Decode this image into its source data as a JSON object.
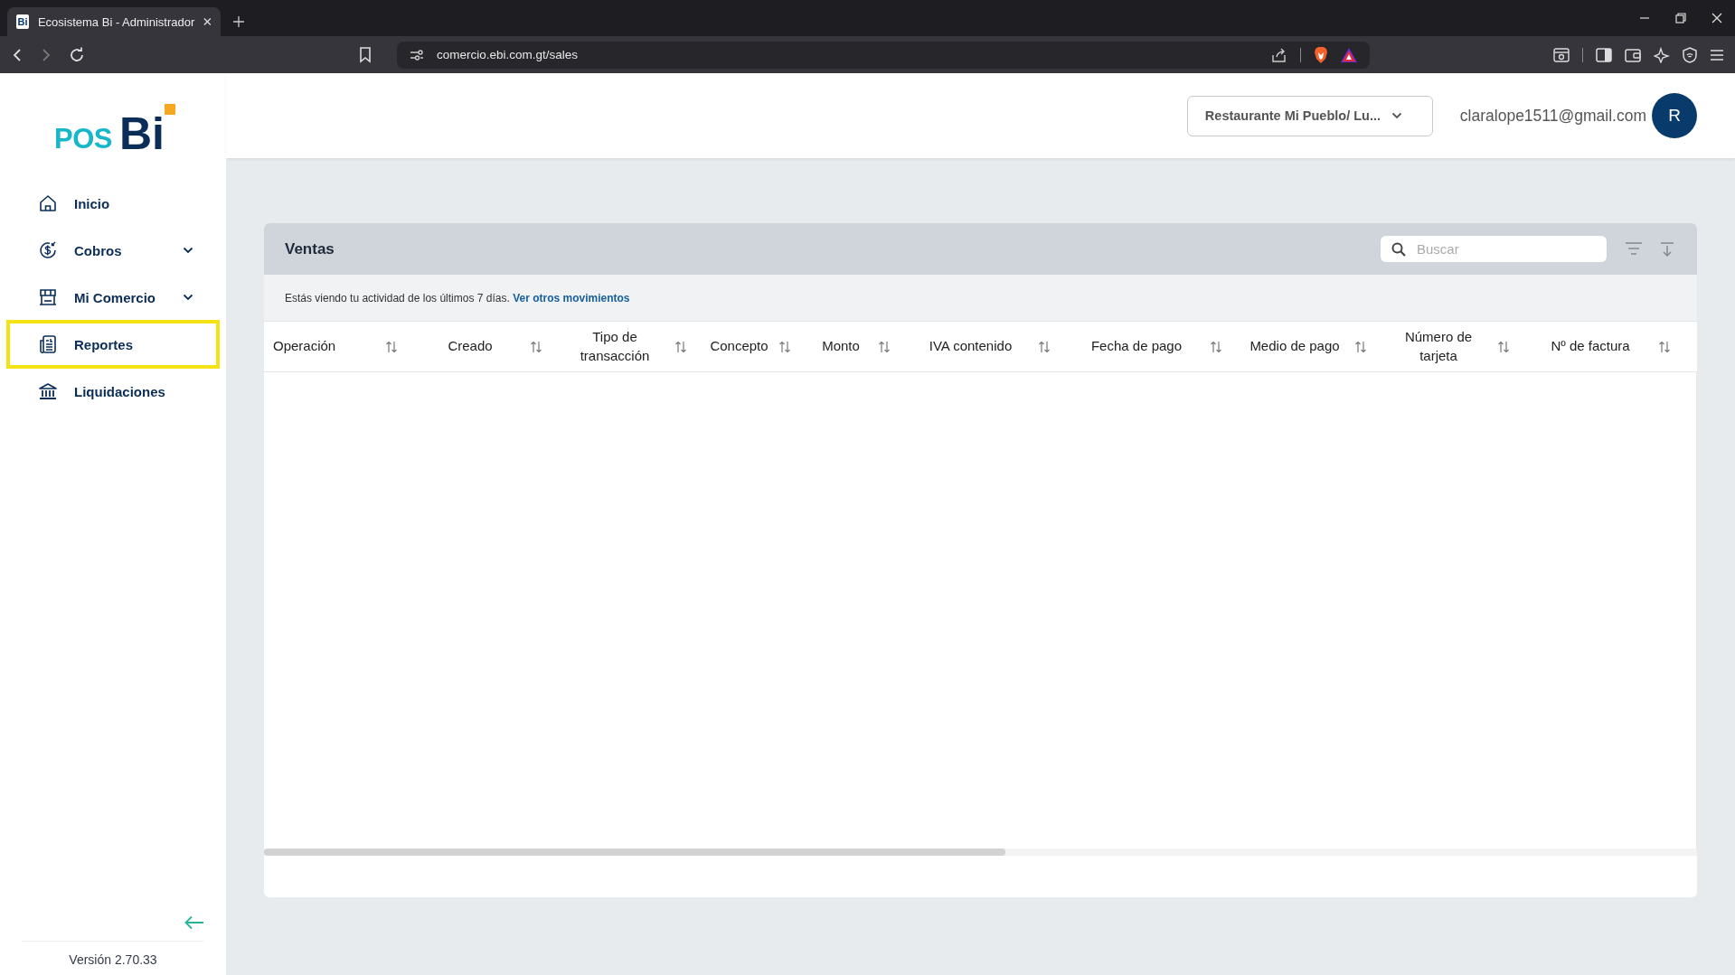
{
  "browser": {
    "tab": {
      "favicon_text": "Bi",
      "title": "Ecosistema Bi - Administrador"
    },
    "url": "comercio.ebi.com.gt/sales"
  },
  "sidebar": {
    "logo": {
      "left": "POS",
      "right": "Bi"
    },
    "items": [
      {
        "label": "Inicio",
        "expandable": false,
        "highlighted": false
      },
      {
        "label": "Cobros",
        "expandable": true,
        "highlighted": false
      },
      {
        "label": "Mi Comercio",
        "expandable": true,
        "highlighted": false
      },
      {
        "label": "Reportes",
        "expandable": false,
        "highlighted": true
      },
      {
        "label": "Liquidaciones",
        "expandable": false,
        "highlighted": false
      }
    ],
    "version": "Versión 2.70.33"
  },
  "header": {
    "store_selector": "Restaurante Mi Pueblo/ Lu...",
    "email": "claralope1511@gmail.com",
    "avatar_initial": "R"
  },
  "card": {
    "title": "Ventas",
    "search": {
      "placeholder": "Buscar"
    },
    "notice": "Estás viendo tu actividad de los últimos 7 días.",
    "notice_link": "Ver otros movimientos",
    "columns": [
      "Operación",
      "Creado",
      "Tipo de transacción",
      "Concepto",
      "Monto",
      "IVA contenido",
      "Fecha de pago",
      "Medio de pago",
      "Número de tarjeta",
      "Nº de factura"
    ]
  }
}
